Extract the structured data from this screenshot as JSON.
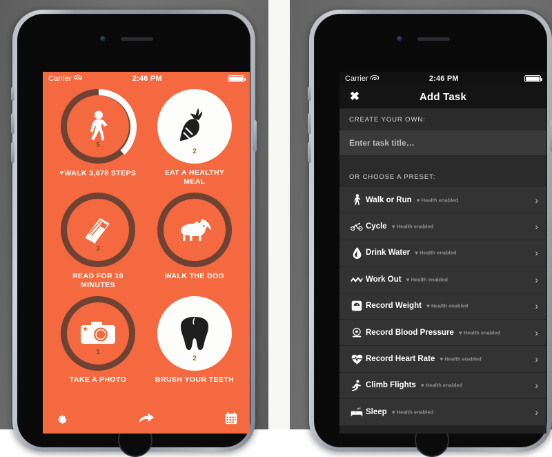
{
  "left_phone": {
    "status_bar": {
      "carrier": "Carrier",
      "time": "2:46 PM",
      "wifi_icon": "wifi-icon",
      "battery_icon": "battery-icon"
    },
    "tasks": [
      {
        "caption": "WALK 3,678 STEPS",
        "heart": "♥",
        "count": "5",
        "style": "ring",
        "progress": 38,
        "icon": "walking-person-icon"
      },
      {
        "caption": "EAT A HEALTHY MEAL",
        "heart": "",
        "count": "2",
        "style": "filled",
        "progress": 0,
        "icon": "carrot-icon"
      },
      {
        "caption": "READ FOR 10 MINUTES",
        "heart": "",
        "count": "3",
        "style": "ring",
        "progress": 0,
        "icon": "book-icon"
      },
      {
        "caption": "WALK THE DOG",
        "heart": "",
        "count": "",
        "style": "ring",
        "progress": 0,
        "icon": "dog-icon"
      },
      {
        "caption": "TAKE A PHOTO",
        "heart": "",
        "count": "1",
        "style": "ring",
        "progress": 0,
        "icon": "camera-icon"
      },
      {
        "caption": "BRUSH YOUR TEETH",
        "heart": "",
        "count": "2",
        "style": "filled",
        "progress": 0,
        "icon": "tooth-icon"
      }
    ],
    "toolbar": [
      {
        "name": "settings-gear-icon",
        "label": "Settings"
      },
      {
        "name": "share-arrow-icon",
        "label": "Share"
      },
      {
        "name": "calendar-icon",
        "label": "Calendar"
      }
    ],
    "colors": {
      "background": "#F4693F",
      "ring": "#6E4333",
      "progress": "#FFFFFF",
      "count": "#8A4A2D"
    }
  },
  "right_phone": {
    "status_bar": {
      "carrier": "Carrier",
      "time": "2:46 PM",
      "wifi_icon": "wifi-icon",
      "battery_icon": "battery-icon"
    },
    "navbar": {
      "close_label": "✖",
      "title": "Add Task"
    },
    "create_section": {
      "header": "CREATE YOUR OWN:",
      "placeholder": "Enter task title…",
      "value": ""
    },
    "preset_section": {
      "header": "OR CHOOSE A PRESET:"
    },
    "presets": [
      {
        "label": "Walk or Run",
        "sub": "Health enabled",
        "heart": "♥",
        "icon": "walking-person-icon",
        "chevron": "›"
      },
      {
        "label": "Cycle",
        "sub": "Health enabled",
        "heart": "♥",
        "icon": "bicycle-icon",
        "chevron": "›"
      },
      {
        "label": "Drink Water",
        "sub": "Health enabled",
        "heart": "♥",
        "icon": "water-drop-icon",
        "chevron": "›"
      },
      {
        "label": "Work Out",
        "sub": "Health enabled",
        "heart": "♥",
        "icon": "dumbbell-icon",
        "chevron": "›"
      },
      {
        "label": "Record Weight",
        "sub": "Health enabled",
        "heart": "♥",
        "icon": "scale-icon",
        "chevron": "›"
      },
      {
        "label": "Record Blood Pressure",
        "sub": "Health enabled",
        "heart": "♥",
        "icon": "blood-pressure-icon",
        "chevron": "›"
      },
      {
        "label": "Record Heart Rate",
        "sub": "Health enabled",
        "heart": "♥",
        "icon": "heart-rate-icon",
        "chevron": "›"
      },
      {
        "label": "Climb Flights",
        "sub": "Health enabled",
        "heart": "♥",
        "icon": "stairs-climb-icon",
        "chevron": "›"
      },
      {
        "label": "Sleep",
        "sub": "Health enabled",
        "heart": "♥",
        "icon": "bed-icon",
        "chevron": "›"
      }
    ],
    "colors": {
      "background": "#232323",
      "row": "#333333",
      "navbar": "#141414",
      "section": "#2B2B2B"
    }
  }
}
